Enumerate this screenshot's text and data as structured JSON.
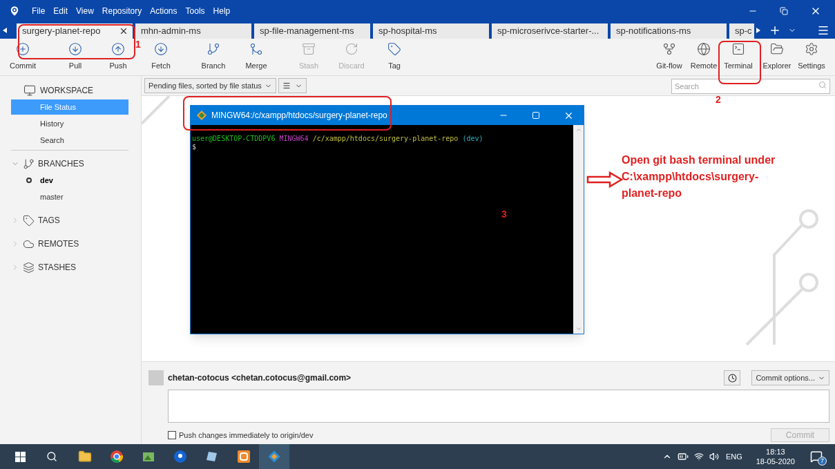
{
  "menu": [
    "File",
    "Edit",
    "View",
    "Repository",
    "Actions",
    "Tools",
    "Help"
  ],
  "tabs": [
    {
      "label": "surgery-planet-repo",
      "selected": true
    },
    {
      "label": "mhn-admin-ms",
      "selected": false
    },
    {
      "label": "sp-file-management-ms",
      "selected": false
    },
    {
      "label": "sp-hospital-ms",
      "selected": false
    },
    {
      "label": "sp-microserivce-starter-...",
      "selected": false
    },
    {
      "label": "sp-notifications-ms",
      "selected": false
    },
    {
      "label": "sp-c",
      "selected": false
    }
  ],
  "toolbar_left": [
    {
      "label": "Commit",
      "disabled": false
    },
    {
      "label": "Pull",
      "disabled": false
    },
    {
      "label": "Push",
      "disabled": false
    },
    {
      "label": "Fetch",
      "disabled": false
    },
    {
      "label": "Branch",
      "disabled": false
    },
    {
      "label": "Merge",
      "disabled": false
    },
    {
      "label": "Stash",
      "disabled": true
    },
    {
      "label": "Discard",
      "disabled": true
    },
    {
      "label": "Tag",
      "disabled": false
    }
  ],
  "toolbar_right": [
    {
      "label": "Git-flow"
    },
    {
      "label": "Remote"
    },
    {
      "label": "Terminal"
    },
    {
      "label": "Explorer"
    },
    {
      "label": "Settings"
    }
  ],
  "sidebar": {
    "workspace": {
      "label": "WORKSPACE",
      "items": [
        {
          "label": "File Status",
          "selected": true
        },
        {
          "label": "History",
          "selected": false
        },
        {
          "label": "Search",
          "selected": false
        }
      ]
    },
    "sections": [
      {
        "label": "BRANCHES",
        "expanded": true,
        "items": [
          {
            "label": "dev",
            "current": true
          },
          {
            "label": "master",
            "current": false
          }
        ]
      },
      {
        "label": "TAGS",
        "expanded": false
      },
      {
        "label": "REMOTES",
        "expanded": false
      },
      {
        "label": "STASHES",
        "expanded": false
      }
    ]
  },
  "filter": {
    "value": "Pending files, sorted by file status"
  },
  "search": {
    "placeholder": "Search"
  },
  "terminal": {
    "title": "MINGW64:/c/xampp/htdocs/surgery-planet-repo",
    "user": "user@DESKTOP-CTDDPV6",
    "shell": "MINGW64",
    "path": "/c/xampp/htdocs/surgery-planet-repo",
    "branch": "(dev)",
    "prompt": "$"
  },
  "annotations": {
    "markers": [
      "1",
      "2",
      "3"
    ],
    "note": "Open git bash terminal under C:\\xampp\\htdocs\\surgery-planet-repo"
  },
  "commit": {
    "author": "chetan-cotocus <chetan.cotocus@gmail.com>",
    "options": "Commit options...",
    "push_label": "Push changes immediately to origin/dev",
    "push_checked": false,
    "button": "Commit",
    "button_disabled": true
  },
  "taskbar": {
    "language": "ENG",
    "time": "18:13",
    "date": "18-05-2020",
    "notifications": "7"
  }
}
